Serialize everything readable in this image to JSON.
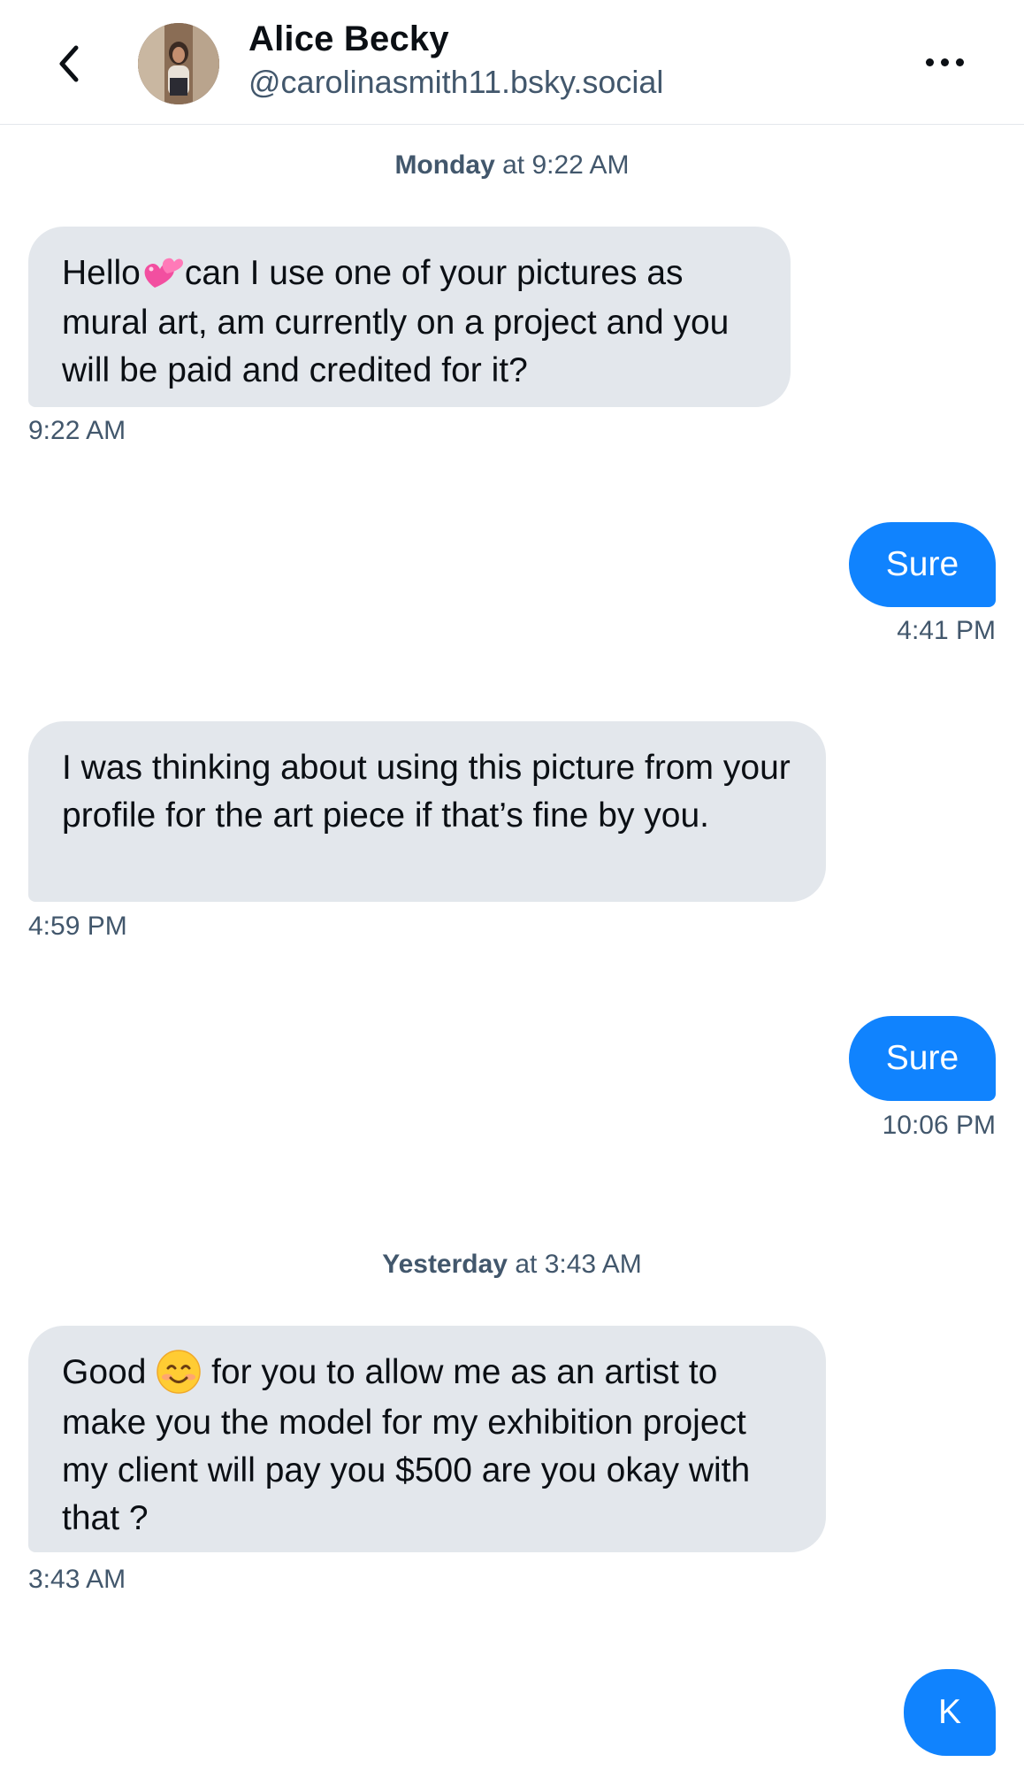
{
  "header": {
    "name": "Alice Becky",
    "handle": "@carolinasmith11.bsky.social",
    "back_icon": "chevron-left-icon",
    "more_icon": "more-horizontal-icon"
  },
  "separators": [
    {
      "day": "Monday",
      "rest": " at 9:22 AM"
    },
    {
      "day": "Yesterday",
      "rest": " at 3:43 AM"
    }
  ],
  "messages": [
    {
      "direction": "incoming",
      "parts": [
        "Hello",
        "can I use one of your pictures as mural art, am currently on a project and you will be paid and credited for it?"
      ],
      "emoji": "two-hearts-emoji",
      "time": "9:22 AM"
    },
    {
      "direction": "outgoing",
      "text": "Sure",
      "time": "4:41 PM"
    },
    {
      "direction": "incoming",
      "text": "I was thinking about using this picture from your profile for the art piece if that’s fine by you.",
      "time": "4:59 PM"
    },
    {
      "direction": "outgoing",
      "text": "Sure",
      "time": "10:06 PM"
    },
    {
      "direction": "incoming",
      "parts": [
        "Good",
        "for you to allow me as an artist to make you the model for my exhibition project my client will pay you $500 are you okay with that ?"
      ],
      "emoji": "smiling-face-emoji",
      "time": "3:43 AM"
    },
    {
      "direction": "outgoing",
      "text": "K",
      "time": ""
    }
  ],
  "colors": {
    "outgoing_bubble": "#1083fe",
    "incoming_bubble": "#e3e7ec",
    "secondary_text": "#42576c"
  }
}
